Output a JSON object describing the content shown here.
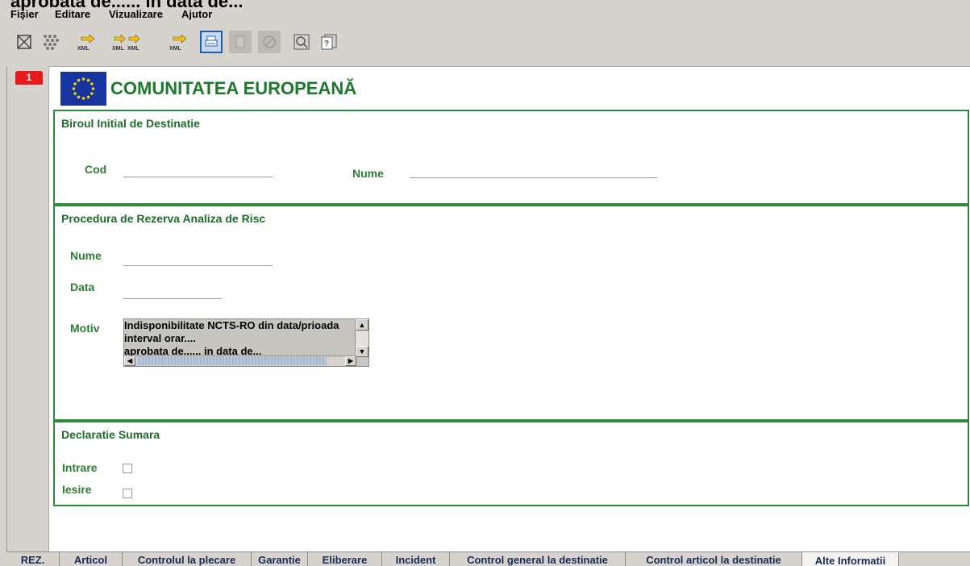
{
  "overlay_text": "aprobata de...... in data de...",
  "menu": [
    "Fişier",
    "Editare",
    "Vizualizare",
    "Ajutor"
  ],
  "toolbar": {
    "xml_label": "XML",
    "icons": [
      "close-document-icon",
      "grid-icon",
      "export-xml-icon",
      "export-xml-double-icon",
      "export-xml-icon-2",
      "print-icon",
      "blank-document-icon",
      "cancel-icon",
      "search-icon",
      "help-icon"
    ]
  },
  "page_tag": "1",
  "header": {
    "title": "COMUNITATEA EUROPEANĂ",
    "flag_color": "#17359e"
  },
  "section_birou": {
    "title": "Biroul Initial de Destinatie",
    "cod_label": "Cod",
    "cod_value": "",
    "nume_label": "Nume",
    "nume_value": ""
  },
  "section_procedura": {
    "title": "Procedura de Rezerva Analiza de Risc",
    "nume_label": "Nume",
    "nume_value": "",
    "data_label": "Data",
    "data_value": "",
    "motiv_label": "Motiv",
    "motiv_lines": [
      "Indisponibilitate NCTS-RO din data/prioada",
      "interval orar....",
      "aprobata de...... in data de..."
    ]
  },
  "section_declaratie": {
    "title": "Declaratie Sumara",
    "intrare_label": "Intrare",
    "intrare_checked": false,
    "iesire_label": "Iesire",
    "iesire_checked": false
  },
  "tabs": [
    "REZ.",
    "Articol",
    "Controlul la plecare",
    "Garantie",
    "Eliberare",
    "Incident",
    "Control general la destinatie",
    "Control articol la destinatie",
    "Alte Informatii"
  ],
  "active_tab": "Alte Informatii",
  "colors": {
    "accent_green": "#2e8b3a",
    "header_green": "#1a7a2a",
    "page_tag_red": "#e51a1a",
    "active_toolbar_blue": "#1f5fa8"
  }
}
